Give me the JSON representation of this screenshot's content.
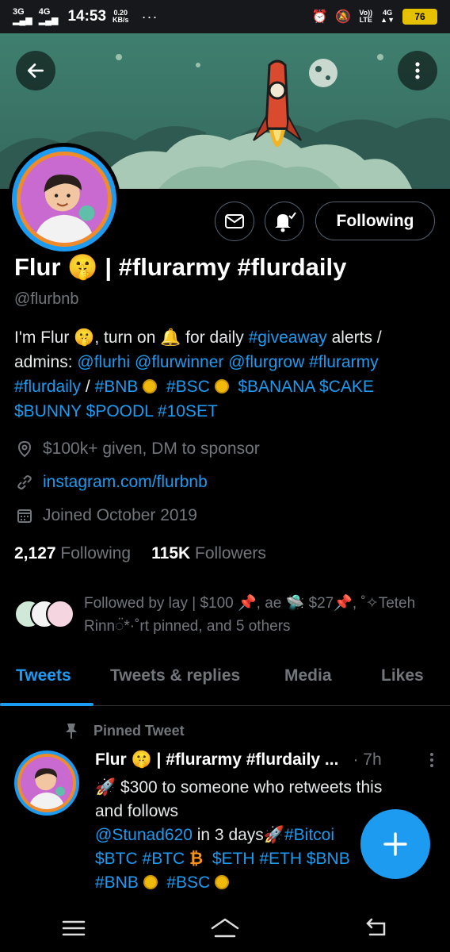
{
  "statusbar": {
    "network1": "3G",
    "network2": "4G",
    "time": "14:53",
    "speed_value": "0.20",
    "speed_unit": "KB/s",
    "more": "···",
    "volte": "Vo))",
    "lte": "LTE",
    "net4g": "4G",
    "battery": "76"
  },
  "profile": {
    "name": "Flur 🤫 | #flurarmy #flurdaily",
    "handle": "@flurbnb",
    "following_button": "Following",
    "bio": {
      "l1a": "I'm Flur 🤫, turn on 🔔 for daily ",
      "l1b": "#giveaway",
      "l1c": " alerts /",
      "l2a": "admins: ",
      "l2b": "@flurhi @flurwinner @flurgrow #flurarmy",
      "l3a": "#flurdaily",
      "l3b": " / ",
      "l3c": "#BNB",
      "l3d": "#BSC",
      "l3e": "$BANANA  $CAKE",
      "l4": "$BUNNY $POODL #10SET"
    },
    "location": "$100k+ given, DM to sponsor",
    "website": "instagram.com/flurbnb",
    "joined": "Joined October 2019",
    "following_count": "2,127",
    "following_label": "Following",
    "followers_count": "115K",
    "followers_label": "Followers",
    "followed_by_line1": "Followed by lay | $100 📌, ae 🛸 $27📌, ˚✧Teteh",
    "followed_by_line2": "Rinn◌̈*·˚rt pinned, and 5 others"
  },
  "tabs": [
    {
      "label": "Tweets"
    },
    {
      "label": "Tweets & replies"
    },
    {
      "label": "Media"
    },
    {
      "label": "Likes"
    }
  ],
  "tweet": {
    "pinned_label": "Pinned Tweet",
    "author": "Flur 🤫 | #flurarmy #flurdaily ...",
    "time": "· 7h",
    "l1": "🚀 $300 to someone who retweets this",
    "l2": "and follows",
    "l3a": "@Stunad620",
    "l3b": " in 3 days🚀",
    "l3c": "#Bitcoi",
    "l4a": "$BTC #BTC",
    "l4b": "$ETH #ETH $BNB",
    "l5a": "#BNB",
    "l5b": "#BSC"
  },
  "icons": {
    "back": "arrow-left-icon",
    "more": "more-vertical-icon",
    "message": "envelope-icon",
    "notify": "bell-check-icon",
    "location": "location-pin-icon",
    "link": "link-icon",
    "calendar": "calendar-icon",
    "pin": "pin-icon",
    "compose": "plus-icon"
  },
  "colors": {
    "accent": "#1d9bf0",
    "background": "#000000",
    "muted": "#71767b",
    "banner": "#3f7f6f"
  }
}
